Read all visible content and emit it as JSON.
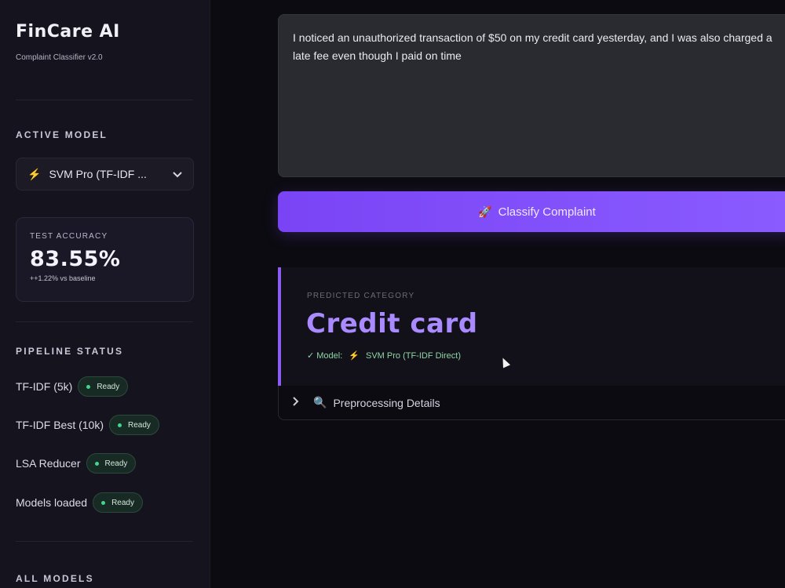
{
  "sidebar": {
    "brand": "FinCare AI",
    "subtitle": "Complaint Classifier v2.0",
    "active_model_title": "ACTIVE MODEL",
    "active_model_value": "SVM Pro (TF-IDF ...",
    "accuracy": {
      "label": "TEST ACCURACY",
      "value": "83.55%",
      "delta": "++1.22% vs baseline"
    },
    "pipeline_title": "PIPELINE STATUS",
    "pipeline": [
      {
        "name": "TF-IDF (5k)",
        "status": "Ready"
      },
      {
        "name": "TF-IDF Best (10k)",
        "status": "Ready"
      },
      {
        "name": "LSA Reducer",
        "status": "Ready"
      },
      {
        "name": "Models loaded",
        "status": "Ready"
      }
    ],
    "all_models_title": "ALL MODELS"
  },
  "main": {
    "complaint_text": "I noticed an unauthorized transaction of $50 on my credit card yesterday, and I was also charged a late fee even though I paid on time",
    "classify_label": "Classify Complaint",
    "result": {
      "label": "PREDICTED CATEGORY",
      "category": "Credit card",
      "model_prefix": "✓ Model:",
      "model_name": "SVM Pro (TF-IDF Direct)"
    },
    "details_label": "Preprocessing Details"
  },
  "icons": {
    "model": "bolt-icon",
    "dropdown": "chevron-down-icon",
    "classify": "rocket-icon",
    "expand": "chevron-right-icon",
    "details": "magnifier-icon"
  },
  "colors": {
    "accent": "#8b5cf6",
    "ready": "#3fd78f",
    "bolt": "#ff8a2a"
  }
}
